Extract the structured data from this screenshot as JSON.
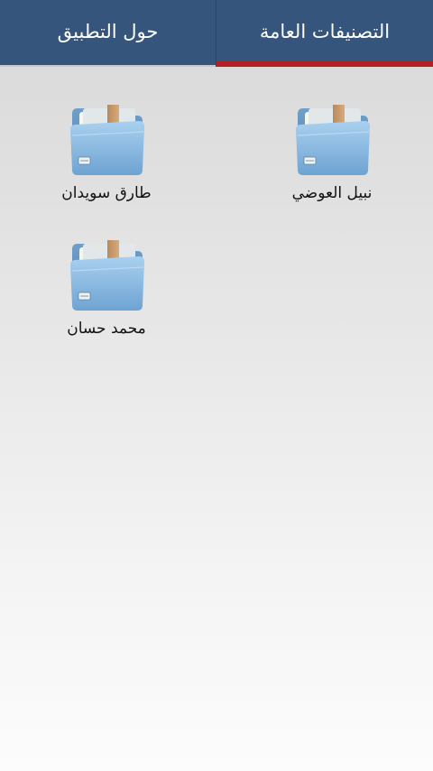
{
  "tabs": [
    {
      "id": "about",
      "label": "حول التطبيق",
      "selected": false
    },
    {
      "id": "categories",
      "label": "التصنيفات العامة",
      "selected": true
    }
  ],
  "items": [
    {
      "label": "نبيل العوضي",
      "icon": "folder-icon"
    },
    {
      "label": "طارق سويدان",
      "icon": "folder-icon"
    },
    {
      "label": "محمد حسان",
      "icon": "folder-icon"
    }
  ],
  "colors": {
    "tabbar": "#35557c",
    "tab_indicator": "#b21f24",
    "folder": "#7fb2dc",
    "folder_tape": "#c79a6a"
  }
}
